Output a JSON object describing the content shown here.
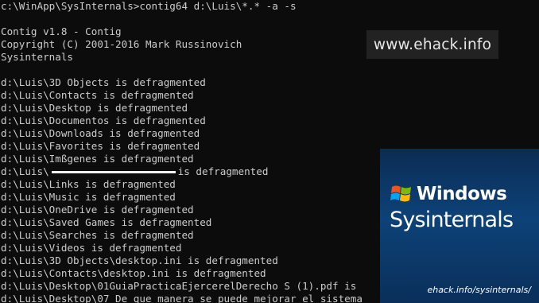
{
  "console": {
    "prompt_line": "c:\\WinApp\\SysInternals>contig64 d:\\Luis\\*.* -a -s",
    "banner": [
      "Contig v1.8 - Contig",
      "Copyright (C) 2001-2016 Mark Russinovich",
      "Sysinternals"
    ],
    "results": [
      "d:\\Luis\\3D Objects is defragmented",
      "d:\\Luis\\Contacts is defragmented",
      "d:\\Luis\\Desktop is defragmented",
      "d:\\Luis\\Documentos is defragmented",
      "d:\\Luis\\Downloads is defragmented",
      "d:\\Luis\\Favorites is defragmented",
      "d:\\Luis\\Imßgenes is defragmented"
    ],
    "redacted_prefix": "d:\\Luis\\",
    "redacted_suffix": "is defragmented",
    "results_after": [
      "d:\\Luis\\Links is defragmented",
      "d:\\Luis\\Music is defragmented",
      "d:\\Luis\\OneDrive is defragmented",
      "d:\\Luis\\Saved Games is defragmented",
      "d:\\Luis\\Searches is defragmented",
      "d:\\Luis\\Videos is defragmented",
      "d:\\Luis\\3D Objects\\desktop.ini is defragmented",
      "d:\\Luis\\Contacts\\desktop.ini is defragmented",
      "d:\\Luis\\Desktop\\01GuiaPracticaEjercerelDerecho S (1).pdf is",
      "d:\\Luis\\Desktop\\07 De que manera se puede mejorar el sistema"
    ]
  },
  "watermark": {
    "text": "www.ehack.info"
  },
  "promo": {
    "brand_top": "Windows",
    "brand_bottom": "Sysinternals",
    "url": "ehack.info/sysinternals/",
    "colors": {
      "red": "#f25022",
      "green": "#7fba00",
      "blue": "#00a4ef",
      "yellow": "#ffb900"
    }
  }
}
